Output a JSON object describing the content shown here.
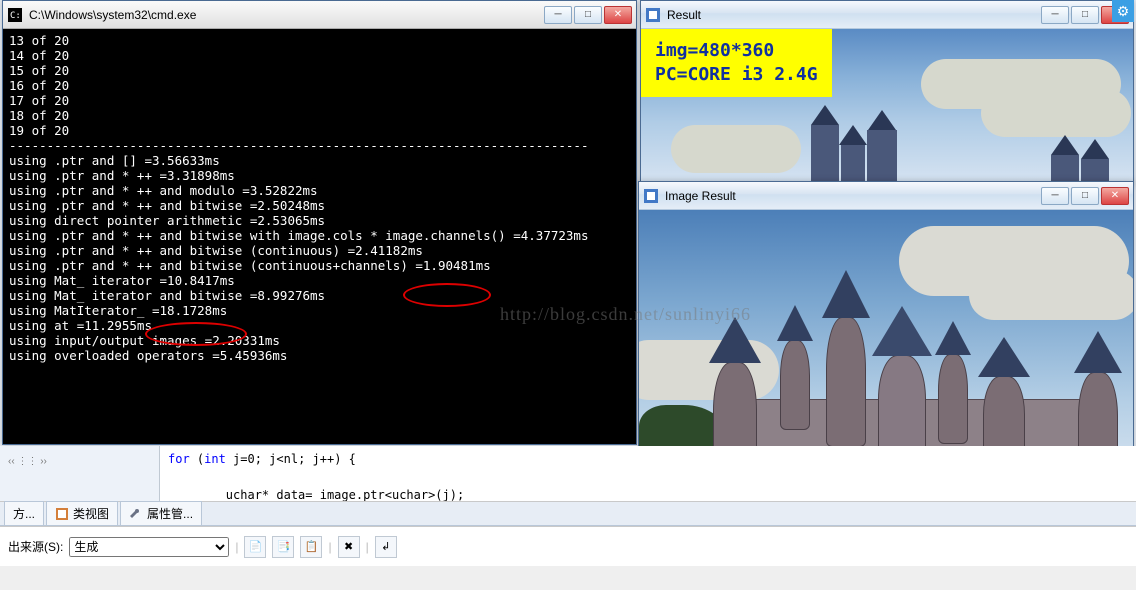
{
  "cmd": {
    "title": "C:\\Windows\\system32\\cmd.exe",
    "lines": [
      "13 of 20",
      "14 of 20",
      "15 of 20",
      "16 of 20",
      "17 of 20",
      "18 of 20",
      "19 of 20",
      "",
      "-----------------------------------------------------------------------------",
      "",
      "using .ptr and [] =3.56633ms",
      "using .ptr and * ++ =3.31898ms",
      "using .ptr and * ++ and modulo =3.52822ms",
      "using .ptr and * ++ and bitwise =2.50248ms",
      "using direct pointer arithmetic =2.53065ms",
      "using .ptr and * ++ and bitwise with image.cols * image.channels() =4.37723ms",
      "using .ptr and * ++ and bitwise (continuous) =2.41182ms",
      "using .ptr and * ++ and bitwise (continuous+channels) =1.90481ms",
      "using Mat_ iterator =10.8417ms",
      "using Mat_ iterator and bitwise =8.99276ms",
      "using MatIterator_ =18.1728ms",
      "using at =11.2955ms",
      "using input/output images =2.20331ms",
      "using overloaded operators =5.45936ms"
    ],
    "highlight_value_1": "=1.90481ms",
    "highlight_value_2": "=18.1728ms"
  },
  "result1": {
    "title": "Result",
    "annot_line1": "img=480*360",
    "annot_line2": "PC=CORE i3 2.4G"
  },
  "result2": {
    "title": "Image Result"
  },
  "ide": {
    "code_line1": "for (int j=0; j<nl; j++) {",
    "code_line2": "        uchar* data= image.ptr<uchar>(j);",
    "tab_left_label": "方...",
    "tab_classview": "类视图",
    "tab_propmgr": "属性管...",
    "out_label": "出来源(S):",
    "out_value": "生成"
  },
  "watermark": "http://blog.csdn.net/sunlinyi66"
}
